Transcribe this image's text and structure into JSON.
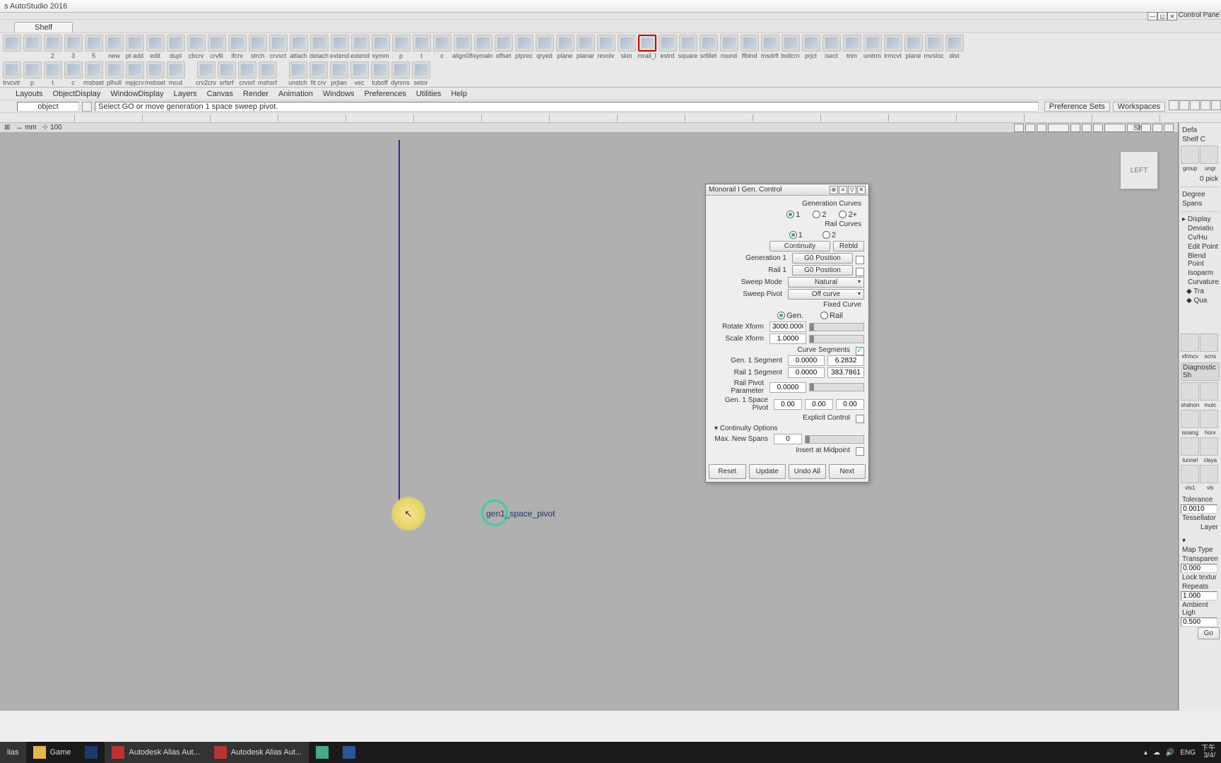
{
  "app": {
    "title": "s AutoStudio 2016"
  },
  "control_panel_label": "Control Pane",
  "shelf_tab": "Shelf",
  "shelf_row1": [
    "",
    "",
    "2",
    "3",
    "5",
    "new",
    "pt add",
    "edit",
    "dupl",
    "cbcrv",
    "crvfil",
    "ifcrv",
    "strch",
    "crvsct",
    "attach",
    "detach",
    "extend",
    "extend",
    "symm",
    "p",
    "t",
    "c",
    "align08",
    "symaln",
    "offset",
    "ptprec",
    "qryed",
    "plane",
    "planar",
    "revolv",
    "skin",
    "mrail_l",
    "estrd",
    "square",
    "srfillet",
    "round",
    "ffblnd",
    "msdrft",
    "bollcrn",
    "prjct",
    "isect",
    "trim",
    "unitrm",
    "trmcvt",
    "plane",
    "mvsloc",
    "dist"
  ],
  "shelf_row2": [
    "trvcvtr",
    "p",
    "t",
    "c",
    "msbset",
    "plhull",
    "mpjcrv",
    "msbset",
    "mcut",
    "",
    "crv2crv",
    "srfsrf",
    "crvsrf",
    "mshsrf",
    "",
    "unstch",
    "fit crv",
    "prjtan",
    "vec",
    "tuboff",
    "dynms",
    "setor"
  ],
  "shelf_group": [
    "group",
    "ungr"
  ],
  "shelf_pick_label": "0 pick",
  "menus": [
    "",
    "Layouts",
    "ObjectDisplay",
    "WindowDisplay",
    "Layers",
    "Canvas",
    "Render",
    "Animation",
    "Windows",
    "Preferences",
    "Utilities",
    "Help"
  ],
  "hint": {
    "pick_mode": "object",
    "message": "Select GO or move generation 1 space sweep pivot.",
    "pref_sets": "Preference Sets",
    "workspaces": "Workspaces"
  },
  "vp": {
    "units": "mm",
    "grid": "100",
    "show": "Show",
    "cube": "LEFT"
  },
  "viewport_label": "gen1_space_pivot",
  "dialog": {
    "title": "Monorail I Gen. Control",
    "gen_curves_label": "Generation Curves",
    "gen_curves_opts": [
      "1",
      "2",
      "2+"
    ],
    "rail_curves_label": "Rail Curves",
    "rail_curves_opts": [
      "1",
      "2"
    ],
    "continuity_btn": "Continuity",
    "rebld_btn": "Rebld",
    "gen1_label": "Generation 1",
    "gen1_btn": "G0 Position",
    "rail1_label": "Rail 1",
    "rail1_btn": "G0 Position",
    "sweep_mode_label": "Sweep Mode",
    "sweep_mode_value": "Natural",
    "sweep_pivot_label": "Sweep Pivot",
    "sweep_pivot_value": "Off curve",
    "fixed_curve_label": "Fixed Curve",
    "fixed_opts": [
      "Gen.",
      "Rail"
    ],
    "rotate_label": "Rotate Xform",
    "rotate_value": "3000.0000",
    "scale_label": "Scale Xform",
    "scale_value": "1.0000",
    "curve_seg_label": "Curve Segments",
    "gen1_seg_label": "Gen. 1 Segment",
    "gen1_seg_a": "0.0000",
    "gen1_seg_b": "6.2832",
    "rail1_seg_label": "Rail 1 Segment",
    "rail1_seg_a": "0.0000",
    "rail1_seg_b": "383.7861",
    "rail_pivot_label": "Rail Pivot Parameter",
    "rail_pivot_value": "0.0000",
    "space_pivot_label": "Gen. 1 Space Pivot",
    "sp_x": "0.00",
    "sp_y": "0.00",
    "sp_z": "0.00",
    "explicit_label": "Explicit Control",
    "cont_opts_label": "Continuity Options",
    "max_spans_label": "Max. New Spans",
    "max_spans_value": "0",
    "insert_mid_label": "Insert at Midpoint",
    "reset": "Reset",
    "update": "Update",
    "undoall": "Undo All",
    "next": "Next"
  },
  "right": {
    "default": "Defa",
    "shelfc": "Shelf C",
    "degree": "Degree",
    "spans": "Spans",
    "display": "Display",
    "items": [
      "Deviatio",
      "Cv/Hu",
      "Edit Point",
      "Blend Point",
      "Isoparm",
      "Curvature"
    ],
    "tra": "Tra",
    "qua": "Qua",
    "diag_row1": [
      "xfrmcv",
      "scns"
    ],
    "diag_head": "Diagnostic Sh",
    "diag_rows": [
      [
        "shdnon",
        "mulc"
      ],
      [
        "isoang",
        "horv"
      ],
      [
        "tunnel",
        "claya"
      ],
      [
        "vis1",
        "vis"
      ]
    ],
    "tolerance": "Tolerance",
    "tolerance_v": "0.0010",
    "tessellator": "Tessellator",
    "layer": "Layer",
    "maptype": "Map Type",
    "transparency": "Transparen",
    "transparency_v": "0.000",
    "locktex": "Lock textur",
    "repeats": "Repeats",
    "repeats_v": "1.000",
    "ambient": "Ambient Ligh",
    "ambient_v": "0.500",
    "go": "Go"
  },
  "taskbar": {
    "items": [
      "lias",
      "Game",
      "",
      "Autodesk Alias Aut...",
      "Autodesk Alias Aut...",
      "",
      ""
    ],
    "lang": "ENG",
    "time1": "下午",
    "time2": "3/4/"
  }
}
